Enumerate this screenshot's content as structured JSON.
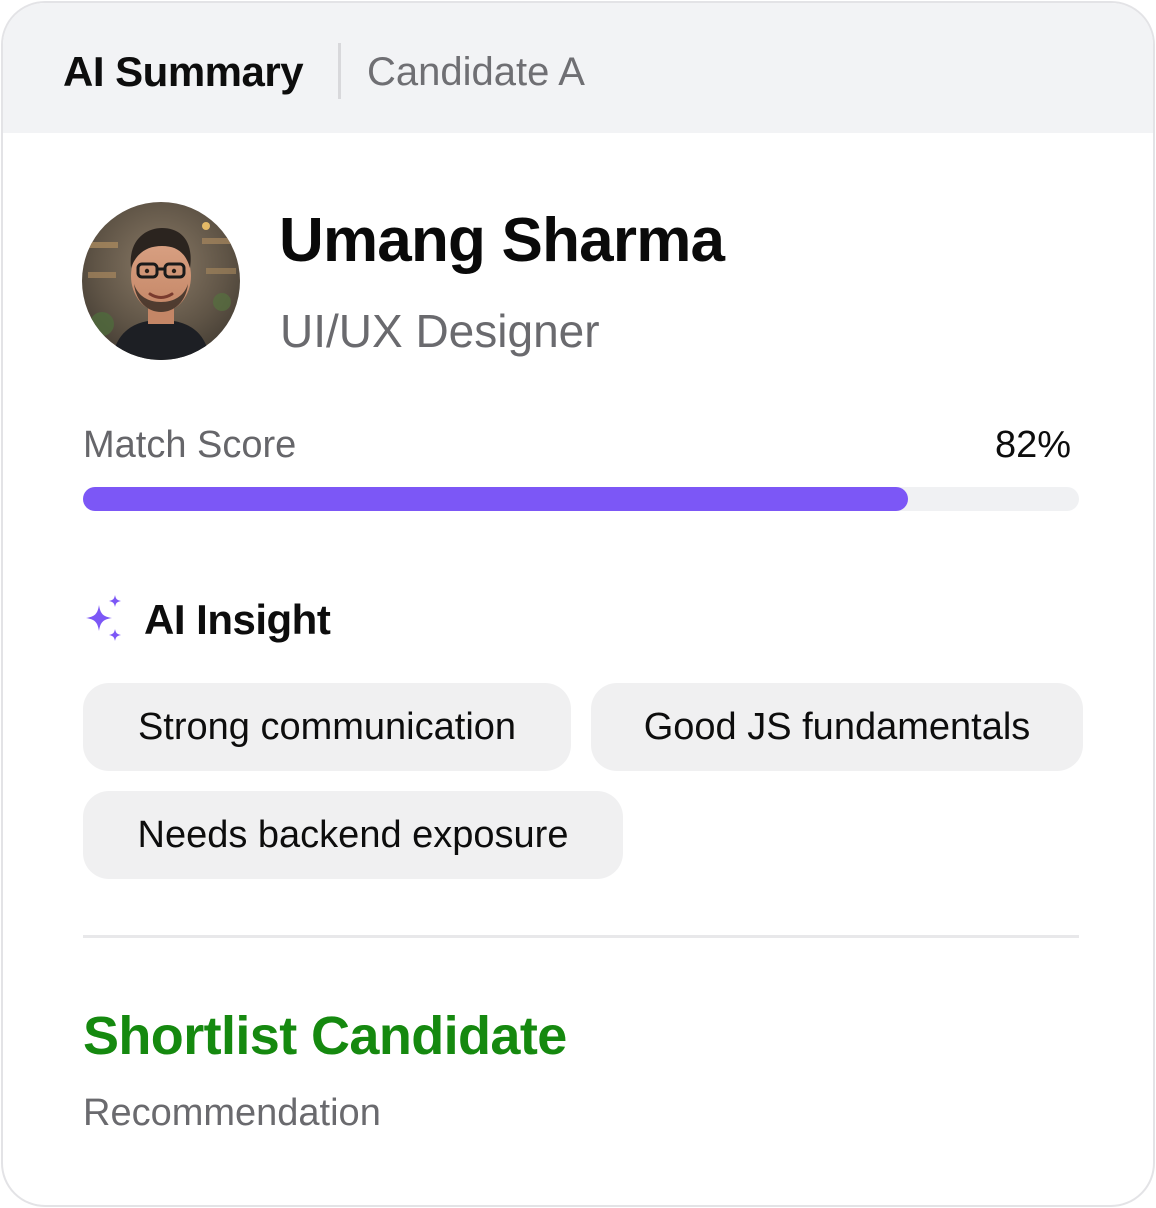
{
  "header": {
    "title": "AI Summary",
    "subtitle": "Candidate A"
  },
  "candidate": {
    "name": "Umang Sharma",
    "role": "UI/UX Designer",
    "avatar_icon": "avatar-photo"
  },
  "match": {
    "label": "Match Score",
    "value_text": "82%",
    "value": 0.82
  },
  "insight": {
    "icon": "sparkle-icon",
    "title": "AI Insight",
    "chips": [
      "Strong communication",
      "Good JS fundamentals",
      "Needs backend exposure"
    ]
  },
  "recommendation": {
    "value": "Shortlist Candidate",
    "label": "Recommendation"
  },
  "colors": {
    "accent": "#7c57f6",
    "success": "#15890f",
    "header_bg": "#f2f3f5",
    "chip_bg": "#f0f0f1"
  }
}
